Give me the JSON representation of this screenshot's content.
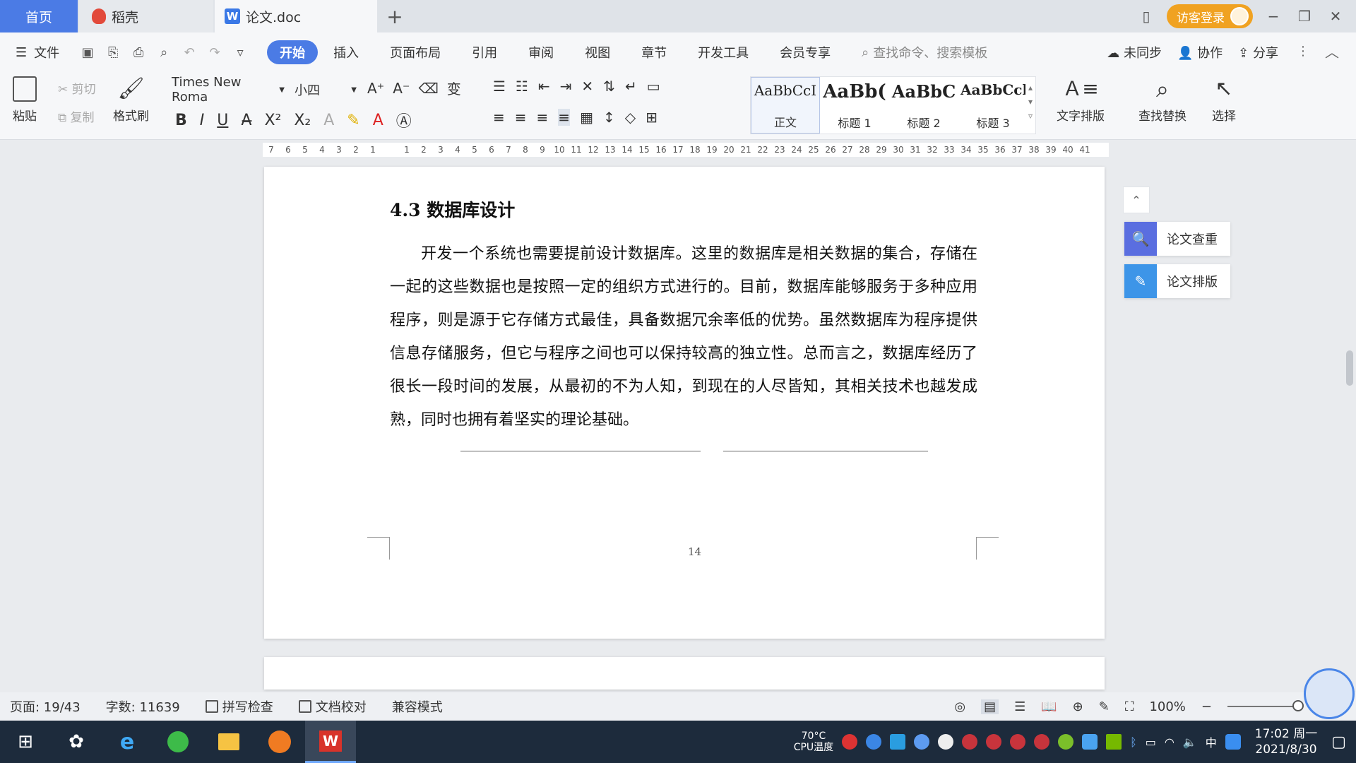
{
  "tabs": {
    "home": "首页",
    "daoke": "稻壳",
    "doc": "论文.doc",
    "add": "+"
  },
  "window": {
    "visitor_login": "访客登录"
  },
  "menu": {
    "file": "文件",
    "items": [
      "开始",
      "插入",
      "页面布局",
      "引用",
      "审阅",
      "视图",
      "章节",
      "开发工具",
      "会员专享"
    ],
    "search_placeholder": "查找命令、搜索模板",
    "unsynced": "未同步",
    "collab": "协作",
    "share": "分享"
  },
  "ribbon": {
    "paste": "粘贴",
    "cut": "剪切",
    "copy": "复制",
    "format_painter": "格式刷",
    "font_name": "Times New Roma",
    "font_size": "小四",
    "styles": [
      {
        "preview": "AaBbCcI",
        "label": "正文"
      },
      {
        "preview": "AaBb(",
        "label": "标题 1"
      },
      {
        "preview": "AaBbC",
        "label": "标题 2"
      },
      {
        "preview": "AaBbCcl",
        "label": "标题 3"
      }
    ],
    "text_layout": "文字排版",
    "find_replace": "查找替换",
    "select": "选择"
  },
  "ruler": {
    "ticks": [
      "7",
      "6",
      "5",
      "4",
      "3",
      "2",
      "1",
      "",
      "1",
      "2",
      "3",
      "4",
      "5",
      "6",
      "7",
      "8",
      "9",
      "10",
      "11",
      "12",
      "13",
      "14",
      "15",
      "16",
      "17",
      "18",
      "19",
      "20",
      "21",
      "22",
      "23",
      "24",
      "25",
      "26",
      "27",
      "28",
      "29",
      "30",
      "31",
      "32",
      "33",
      "34",
      "35",
      "36",
      "37",
      "38",
      "39",
      "40",
      "41"
    ]
  },
  "document": {
    "heading": "4.3  数据库设计",
    "paragraph": "开发一个系统也需要提前设计数据库。这里的数据库是相关数据的集合，存储在一起的这些数据也是按照一定的组织方式进行的。目前，数据库能够服务于多种应用程序，则是源于它存储方式最佳，具备数据冗余率低的优势。虽然数据库为程序提供信息存储服务，但它与程序之间也可以保持较高的独立性。总而言之，数据库经历了很长一段时间的发展，从最初的不为人知，到现在的人尽皆知，其相关技术也越发成熟，同时也拥有着坚实的理论基础。",
    "page_number": "14"
  },
  "side_panel": {
    "check": "论文查重",
    "layout": "论文排版"
  },
  "status": {
    "page": "页面: 19/43",
    "words": "字数: 11639",
    "spell": "拼写检查",
    "proof": "文档校对",
    "compat": "兼容模式",
    "zoom": "100%"
  },
  "taskbar": {
    "cpu_temp": "70°C",
    "cpu_label": "CPU温度",
    "ime": "中",
    "time": "17:02 周一",
    "date": "2021/8/30"
  },
  "colors": {
    "accent": "#4b7be5",
    "visitor": "#f0a221",
    "taskbar": "#1d2b3c"
  }
}
